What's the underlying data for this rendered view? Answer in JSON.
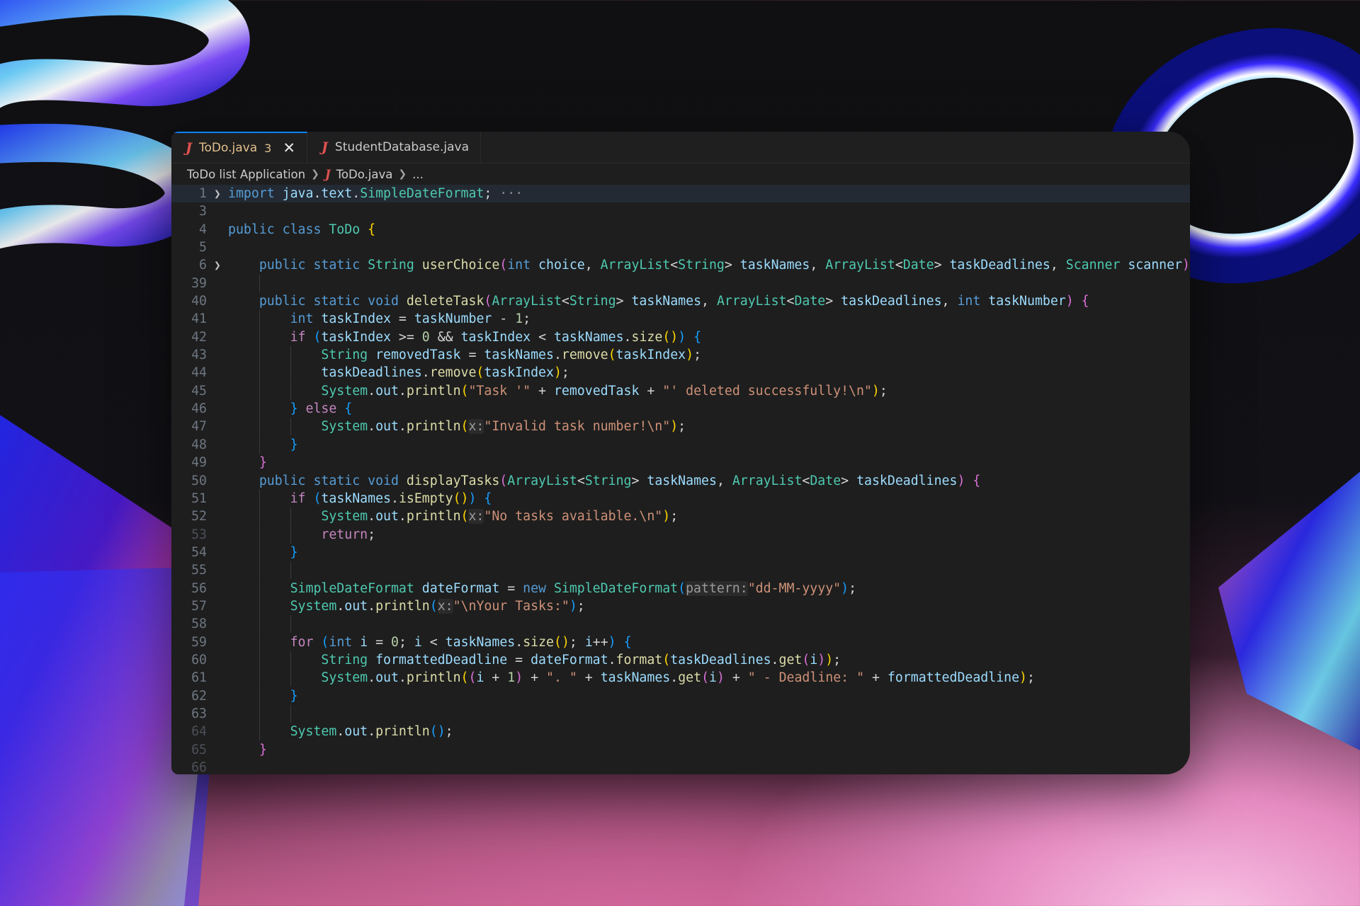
{
  "tabs": [
    {
      "icon": "java-icon",
      "label": "ToDo.java",
      "badge": "3",
      "active": true
    },
    {
      "icon": "java-icon",
      "label": "StudentDatabase.java",
      "active": false
    }
  ],
  "breadcrumb": {
    "folder": "ToDo list Application",
    "file": "ToDo.java",
    "symbol": "..."
  },
  "colors": {
    "keyword": "#569cd6",
    "control": "#c586c0",
    "type": "#4ec9b0",
    "function": "#dcdcaa",
    "variable": "#9cdcfe",
    "string": "#ce9178",
    "number": "#b5cea8",
    "editor_bg": "#1e1e1e",
    "tab_modified": "#e2c08d",
    "java_icon": "#e0524f"
  },
  "code": {
    "lines": [
      {
        "n": "1",
        "fold": ">",
        "text": "import java.text.SimpleDateFormat;",
        "tail": "···"
      },
      {
        "n": "3",
        "text": ""
      },
      {
        "n": "4",
        "text": "public class ToDo {"
      },
      {
        "n": "5",
        "text": ""
      },
      {
        "n": "6",
        "fold": ">",
        "text": "    public static String userChoice(int choice, ArrayList<String> taskNames, ArrayList<Date> taskDeadlines, Scanner scanner) {",
        "tail": "···"
      },
      {
        "n": "39",
        "text": ""
      },
      {
        "n": "40",
        "text": "    public static void deleteTask(ArrayList<String> taskNames, ArrayList<Date> taskDeadlines, int taskNumber) {"
      },
      {
        "n": "41",
        "text": "        int taskIndex = taskNumber - 1;"
      },
      {
        "n": "42",
        "text": "        if (taskIndex >= 0 && taskIndex < taskNames.size()) {"
      },
      {
        "n": "43",
        "text": "            String removedTask = taskNames.remove(taskIndex);"
      },
      {
        "n": "44",
        "text": "            taskDeadlines.remove(taskIndex);"
      },
      {
        "n": "45",
        "text": "            System.out.println(\"Task '\" + removedTask + \"' deleted successfully!\\n\");"
      },
      {
        "n": "46",
        "text": "        } else {"
      },
      {
        "n": "47",
        "text": "            System.out.println(x:\"Invalid task number!\\n\");"
      },
      {
        "n": "48",
        "text": "        }"
      },
      {
        "n": "49",
        "text": "    }"
      },
      {
        "n": "50",
        "text": "    public static void displayTasks(ArrayList<String> taskNames, ArrayList<Date> taskDeadlines) {"
      },
      {
        "n": "51",
        "text": "        if (taskNames.isEmpty()) {"
      },
      {
        "n": "52",
        "text": "            System.out.println(x:\"No tasks available.\\n\");"
      },
      {
        "n": "53",
        "text": "            return;"
      },
      {
        "n": "54",
        "text": "        }"
      },
      {
        "n": "55",
        "text": ""
      },
      {
        "n": "56",
        "text": "        SimpleDateFormat dateFormat = new SimpleDateFormat(pattern:\"dd-MM-yyyy\");"
      },
      {
        "n": "57",
        "text": "        System.out.println(x:\"\\nYour Tasks:\");"
      },
      {
        "n": "58",
        "text": ""
      },
      {
        "n": "59",
        "text": "        for (int i = 0; i < taskNames.size(); i++) {"
      },
      {
        "n": "60",
        "text": "            String formattedDeadline = dateFormat.format(taskDeadlines.get(i));"
      },
      {
        "n": "61",
        "text": "            System.out.println((i + 1) + \". \" + taskNames.get(i) + \" - Deadline: \" + formattedDeadline);"
      },
      {
        "n": "62",
        "text": "        }"
      },
      {
        "n": "63",
        "text": ""
      },
      {
        "n": "64",
        "text": "        System.out.println();"
      },
      {
        "n": "65",
        "text": "    }"
      },
      {
        "n": "66",
        "text": ""
      }
    ]
  }
}
